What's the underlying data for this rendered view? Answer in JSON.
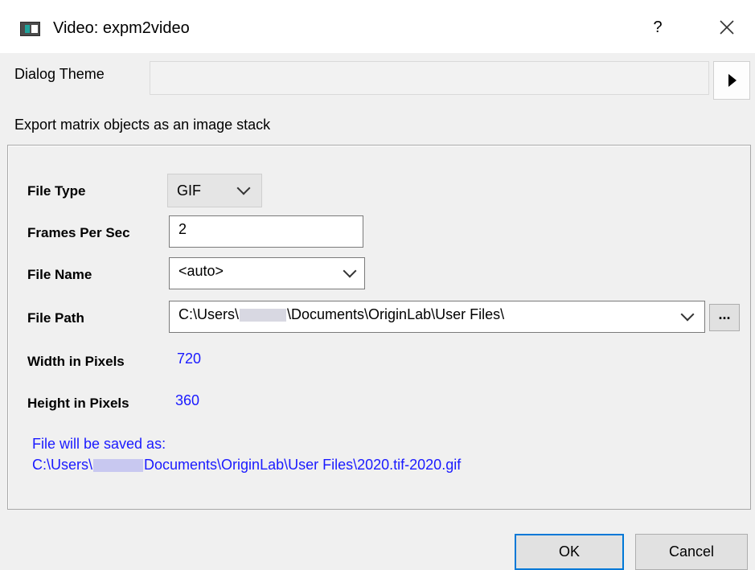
{
  "window": {
    "title": "Video: expm2video",
    "help_label": "?"
  },
  "theme": {
    "label": "Dialog Theme",
    "value": ""
  },
  "description": "Export matrix objects as an image stack",
  "fields": {
    "file_type": {
      "label": "File Type",
      "value": "GIF"
    },
    "frames_per_sec": {
      "label": "Frames Per Sec",
      "value": "2"
    },
    "file_name": {
      "label": "File Name",
      "value": "<auto>"
    },
    "file_path": {
      "label": "File Path",
      "value_prefix": "C:\\Users\\",
      "value_suffix": "\\Documents\\OriginLab\\User Files\\",
      "browse_label": "..."
    },
    "width": {
      "label": "Width in Pixels",
      "value": "720"
    },
    "height": {
      "label": "Height in Pixels",
      "value": "360"
    }
  },
  "save_info": {
    "line1": "File will be saved as:",
    "line2_prefix": "C:\\Users\\",
    "line2_suffix": "Documents\\OriginLab\\User Files\\2020.tif-2020.gif"
  },
  "buttons": {
    "ok": "OK",
    "cancel": "Cancel"
  },
  "colors": {
    "accent": "#0078d7",
    "info_text": "#1a1aff"
  }
}
